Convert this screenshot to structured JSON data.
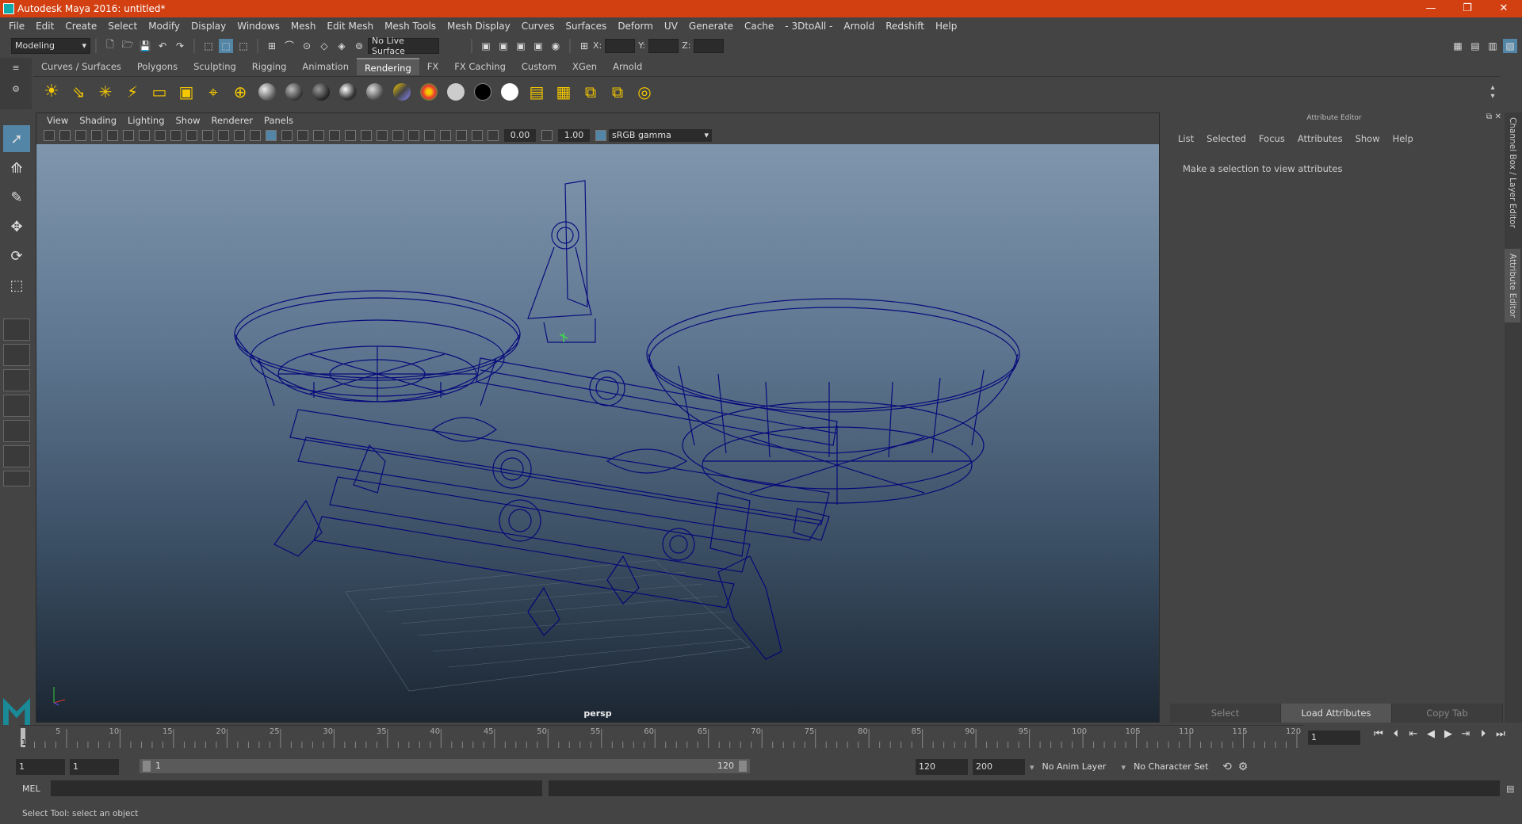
{
  "window": {
    "title": "Autodesk Maya 2016: untitled*",
    "minimize": "—",
    "restore": "❐",
    "close": "✕"
  },
  "menu": [
    "File",
    "Edit",
    "Create",
    "Select",
    "Modify",
    "Display",
    "Windows",
    "Mesh",
    "Edit Mesh",
    "Mesh Tools",
    "Mesh Display",
    "Curves",
    "Surfaces",
    "Deform",
    "UV",
    "Generate",
    "Cache",
    "- 3DtoAll -",
    "Arnold",
    "Redshift",
    "Help"
  ],
  "status": {
    "menuset": "Modeling",
    "live_surface": "No Live Surface",
    "x_label": "X:",
    "y_label": "Y:",
    "z_label": "Z:"
  },
  "shelf_tabs": [
    "Curves / Surfaces",
    "Polygons",
    "Sculpting",
    "Rigging",
    "Animation",
    "Rendering",
    "FX",
    "FX Caching",
    "Custom",
    "XGen",
    "Arnold"
  ],
  "active_shelf_tab": "Rendering",
  "viewport": {
    "menu": [
      "View",
      "Shading",
      "Lighting",
      "Show",
      "Renderer",
      "Panels"
    ],
    "exposure": "0.00",
    "gamma": "1.00",
    "color_space": "sRGB gamma",
    "camera_label": "persp"
  },
  "attribute_editor": {
    "title": "Attribute Editor",
    "menu": [
      "List",
      "Selected",
      "Focus",
      "Attributes",
      "Show",
      "Help"
    ],
    "message": "Make a selection to view attributes",
    "buttons": {
      "select": "Select",
      "load": "Load Attributes",
      "copy": "Copy Tab"
    }
  },
  "side_tabs": {
    "channel_box": "Channel Box / Layer Editor",
    "attribute_editor": "Attribute Editor"
  },
  "timeline": {
    "ticks": [
      "5",
      "10",
      "15",
      "20",
      "25",
      "30",
      "35",
      "40",
      "45",
      "50",
      "55",
      "60",
      "65",
      "70",
      "75",
      "80",
      "85",
      "90",
      "95",
      "100",
      "105",
      "110",
      "115",
      "120"
    ],
    "start_frame": "1",
    "current_frame": "1"
  },
  "range": {
    "start": "1",
    "anim_start": "1",
    "slider_start": "1",
    "slider_end": "120",
    "end": "120",
    "anim_end": "200",
    "anim_layer": "No Anim Layer",
    "character_set": "No Character Set"
  },
  "command_line": {
    "label": "MEL"
  },
  "help_line": "Select Tool: select an object",
  "colors": {
    "titlebar": "#d24011",
    "wireframe": "#00007a",
    "selected_tool": "#5285a6"
  }
}
